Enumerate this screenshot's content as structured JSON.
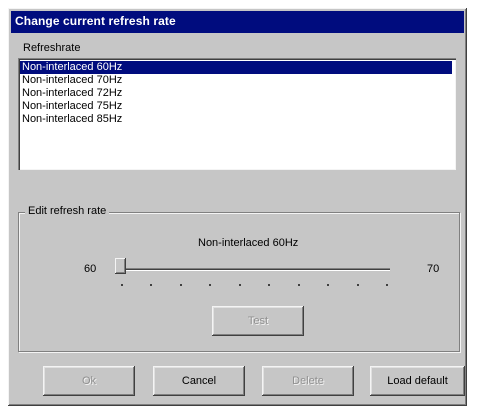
{
  "window": {
    "title": "Change current refresh rate"
  },
  "refresh_rate_label": "Refreshrate",
  "list": {
    "items": [
      {
        "label": "Non-interlaced 60Hz",
        "selected": true
      },
      {
        "label": "Non-interlaced 70Hz",
        "selected": false
      },
      {
        "label": "Non-interlaced 72Hz",
        "selected": false
      },
      {
        "label": "Non-interlaced 75Hz",
        "selected": false
      },
      {
        "label": "Non-interlaced 85Hz",
        "selected": false
      }
    ]
  },
  "edit_group": {
    "label": "Edit refresh rate",
    "current_value_label": "Non-interlaced 60Hz",
    "min_label": "60",
    "max_label": "70",
    "slider_value": 60,
    "tick_count": 10
  },
  "buttons": {
    "test": "Test",
    "ok": "Ok",
    "cancel": "Cancel",
    "delete": "Delete",
    "load_default": "Load default"
  },
  "colors": {
    "titlebar": "#000c7e",
    "selection": "#000c7e",
    "face": "#c6c6c6"
  }
}
